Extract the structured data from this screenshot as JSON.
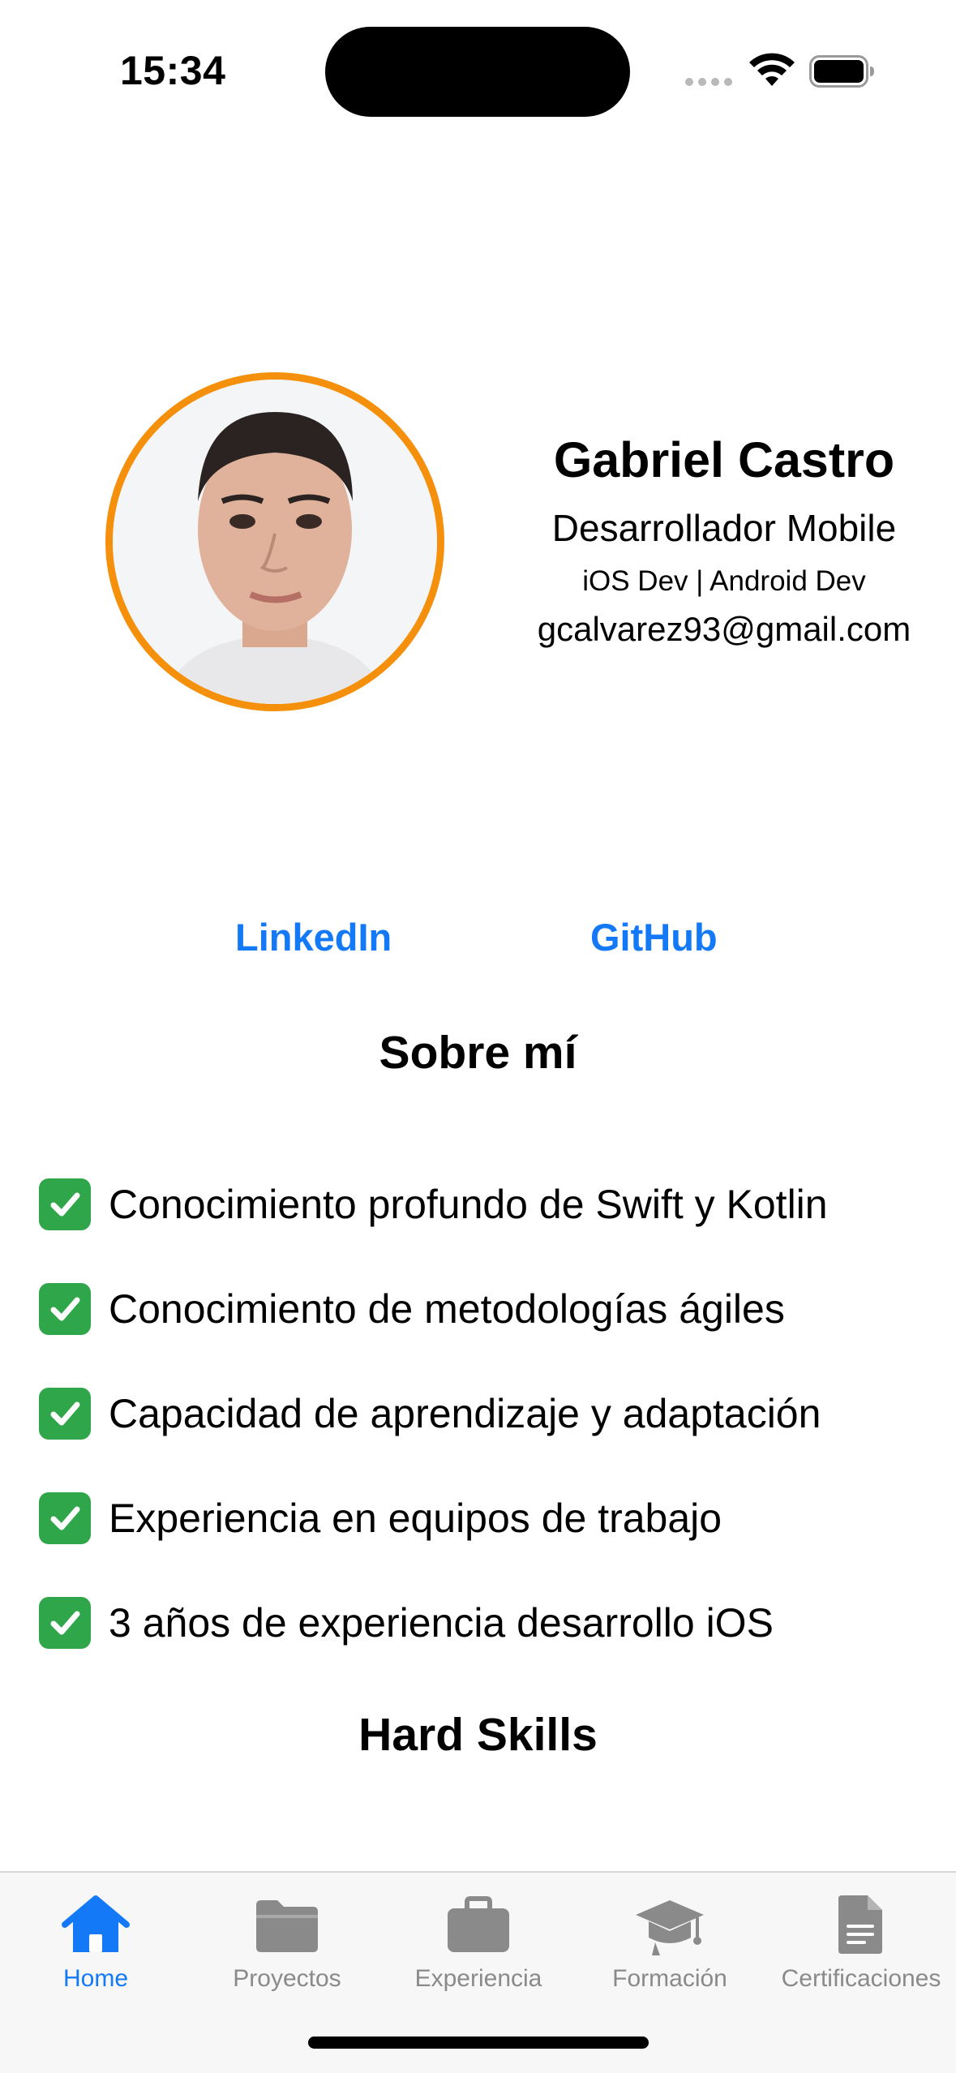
{
  "status_bar": {
    "time": "15:34"
  },
  "profile": {
    "name": "Gabriel Castro",
    "role": "Desarrollador Mobile",
    "tags": "iOS Dev | Android Dev",
    "email": "gcalvarez93@gmail.com",
    "avatar_border_color": "#F5900C"
  },
  "links": {
    "linkedin": "LinkedIn",
    "github": "GitHub",
    "color": "#1479F6"
  },
  "about": {
    "title": "Sobre mí",
    "items": [
      "Conocimiento profundo de Swift y Kotlin",
      "Conocimiento de metodologías ágiles",
      "Capacidad de aprendizaje y adaptación",
      "Experiencia en equipos de trabajo",
      "3 años de experiencia desarrollo iOS"
    ]
  },
  "hard_skills": {
    "title": "Hard Skills"
  },
  "tab_bar": {
    "tabs": [
      {
        "label": "Home",
        "icon": "house-icon",
        "active": true
      },
      {
        "label": "Proyectos",
        "icon": "folder-icon",
        "active": false
      },
      {
        "label": "Experiencia",
        "icon": "briefcase-icon",
        "active": false
      },
      {
        "label": "Formación",
        "icon": "graduation-cap-icon",
        "active": false
      },
      {
        "label": "Certificaciones",
        "icon": "document-icon",
        "active": false
      }
    ],
    "active_color": "#1479F6",
    "inactive_color": "#8A8A8A"
  }
}
